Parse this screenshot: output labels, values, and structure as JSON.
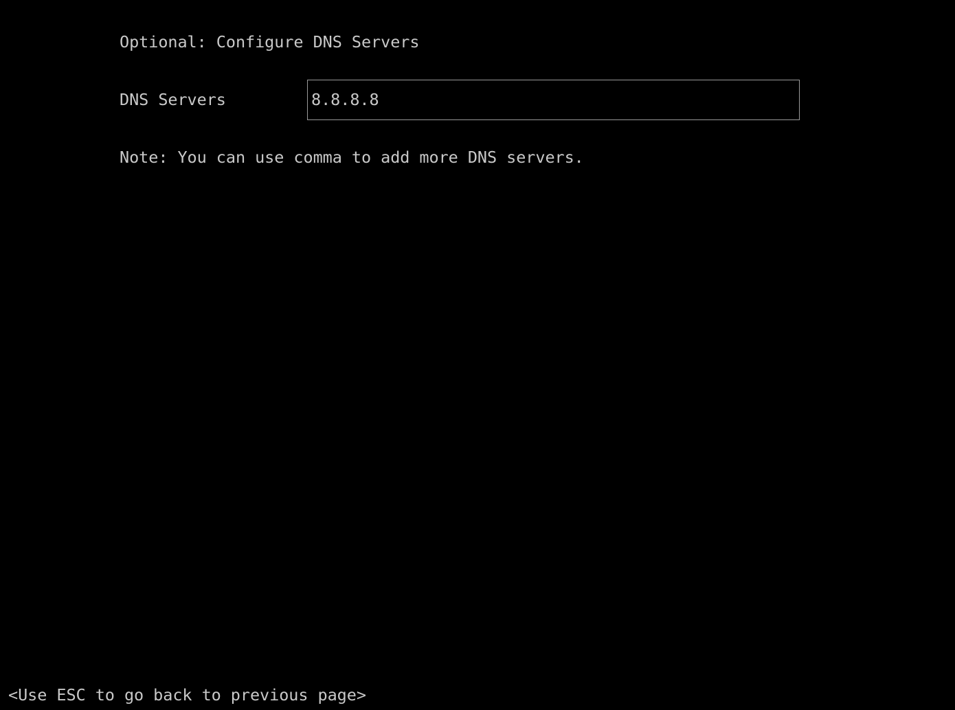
{
  "screen": {
    "background_color": "#000000",
    "text_color": "#c8c8c8",
    "border_color": "#9a9a9a",
    "title": "Optional: Configure DNS Servers"
  },
  "form": {
    "dns": {
      "label": "DNS Servers",
      "value": "8.8.8.8",
      "placeholder": ""
    }
  },
  "note": {
    "text": "Note: You can use comma to add more DNS servers."
  },
  "footer": {
    "hint": "<Use ESC to go back to previous page>"
  }
}
